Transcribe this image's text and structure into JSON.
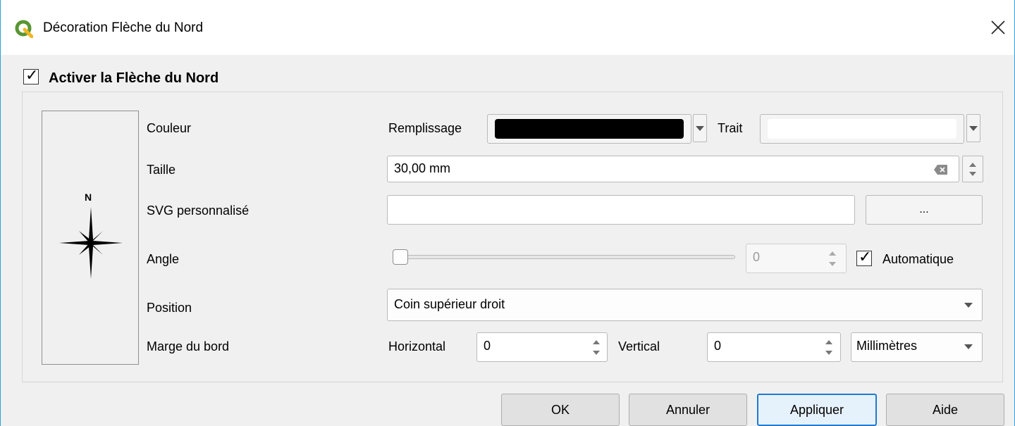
{
  "window": {
    "title": "Décoration Flèche du Nord"
  },
  "enable": {
    "label": "Activer la Flèche du Nord",
    "checked": true
  },
  "preview": {
    "north_letter": "N"
  },
  "rows": {
    "color_label": "Couleur",
    "size_label": "Taille",
    "svg_label": "SVG personnalisé",
    "angle_label": "Angle",
    "position_label": "Position",
    "margin_label": "Marge du bord"
  },
  "color": {
    "fill_label": "Remplissage",
    "fill_color": "#000000",
    "stroke_label": "Trait",
    "stroke_color": "#ffffff"
  },
  "size": {
    "value": "30,00 mm"
  },
  "svg": {
    "path": "",
    "browse_label": "..."
  },
  "angle": {
    "value": "0",
    "slider_fraction": 0,
    "auto_label": "Automatique",
    "auto_checked": true
  },
  "position": {
    "selected": "Coin supérieur droit"
  },
  "margin": {
    "horizontal_label": "Horizontal",
    "horizontal_value": "0",
    "vertical_label": "Vertical",
    "vertical_value": "0",
    "unit": "Millimètres"
  },
  "buttons": {
    "ok": "OK",
    "cancel": "Annuler",
    "apply": "Appliquer",
    "help": "Aide"
  },
  "colors": {
    "accent": "#1f7ad2",
    "qgis_green": "#589632",
    "qgis_yellow": "#f0b623"
  }
}
